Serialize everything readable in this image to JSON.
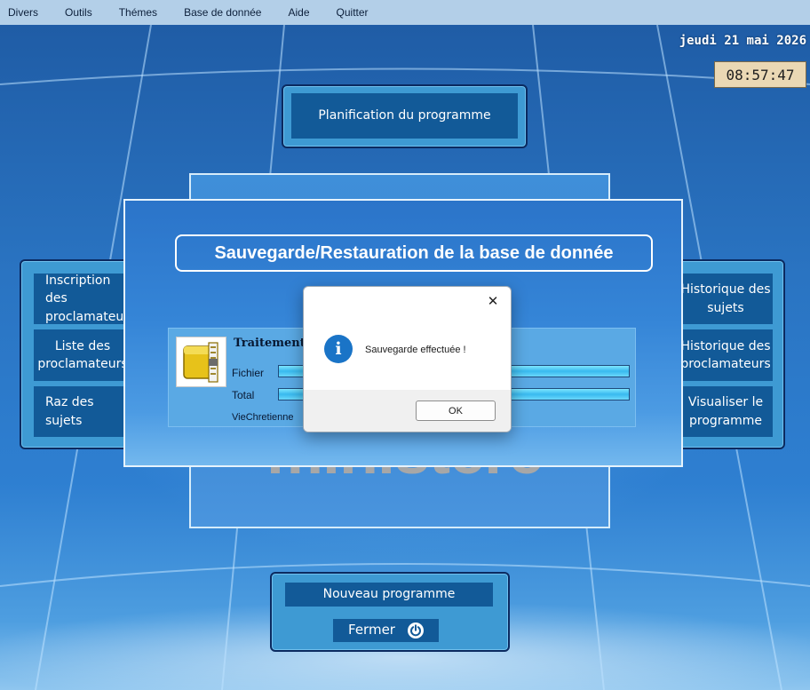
{
  "menu": {
    "items": [
      "Divers",
      "Outils",
      "Thémes",
      "Base de donnée",
      "Aide",
      "Quitter"
    ]
  },
  "header": {
    "date": "jeudi 21 mai 2026",
    "time": "08:57:47"
  },
  "main": {
    "planning_button": "Planification du programme",
    "left_menu": [
      "Inscription des proclamateurs",
      "Liste des proclamateurs",
      "Raz des sujets"
    ],
    "right_menu": [
      "Historique des sujets",
      "Historique des proclamateurs",
      "Visualiser le programme"
    ],
    "logo_word": "ministere",
    "new_program_button": "Nouveau programme",
    "close_button": "Fermer"
  },
  "backup_dialog": {
    "title": "Sauvegarde/Restauration de la base de donnée",
    "processing_label": "Traitement",
    "file_label": "Fichier",
    "total_label": "Total",
    "filename": "VieChretienne",
    "file_progress": 1.0,
    "total_progress": 1.0
  },
  "message_box": {
    "text": "Sauvegarde effectuée !",
    "ok_label": "OK",
    "close_glyph": "✕"
  },
  "colors": {
    "accent": "#125a98",
    "panel": "#3e9ad3",
    "clock_bg": "#ead8b4",
    "info_icon": "#1a74c7"
  }
}
